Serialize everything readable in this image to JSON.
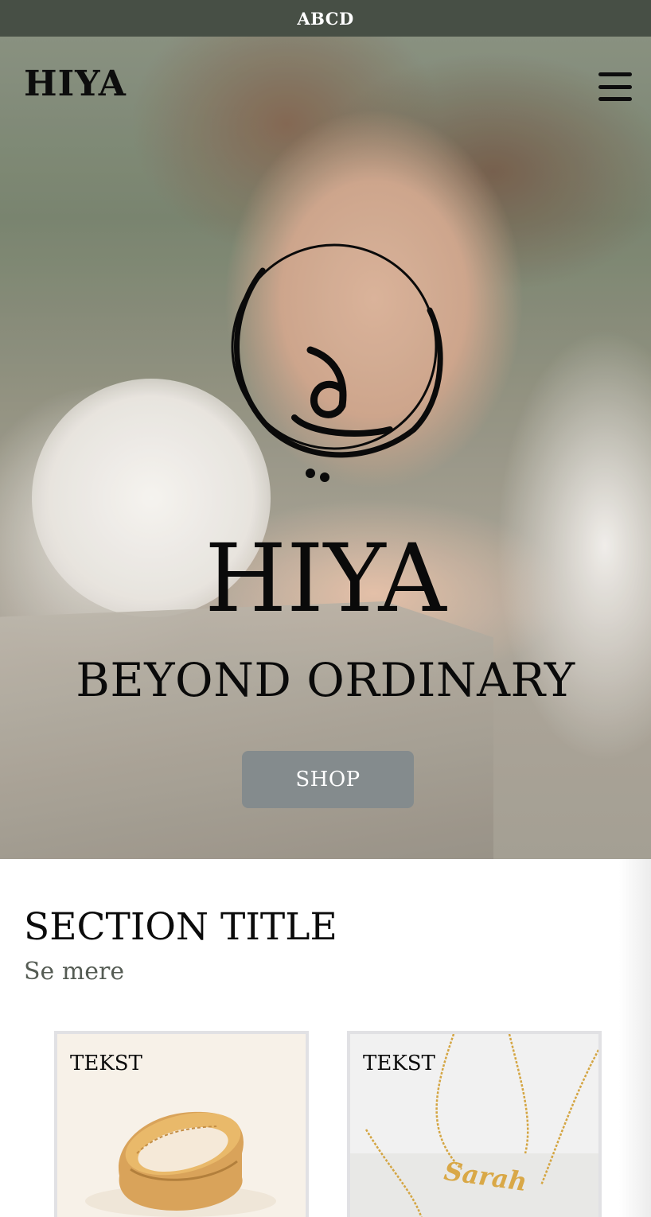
{
  "announcement": {
    "text": "ABCD"
  },
  "header": {
    "logo": "HIYA",
    "menu_icon": "hamburger-menu-icon"
  },
  "hero": {
    "title": "HIYA",
    "tagline": "BEYOND ORDINARY",
    "cta_label": "SHOP",
    "emblem_icon": "arabic-calligraphy-logo-icon"
  },
  "section": {
    "title": "SECTION TITLE",
    "see_more": "Se mere",
    "products": [
      {
        "label": "TEKST",
        "image": "gold-ring-image"
      },
      {
        "label": "TEKST",
        "image": "gold-name-necklace-image",
        "engraving": "Sarah"
      }
    ]
  },
  "colors": {
    "announcement_bg": "#474f45",
    "cta_bg": "#848b8d",
    "see_more": "#545b53",
    "card_border": "#e1e1e4"
  }
}
